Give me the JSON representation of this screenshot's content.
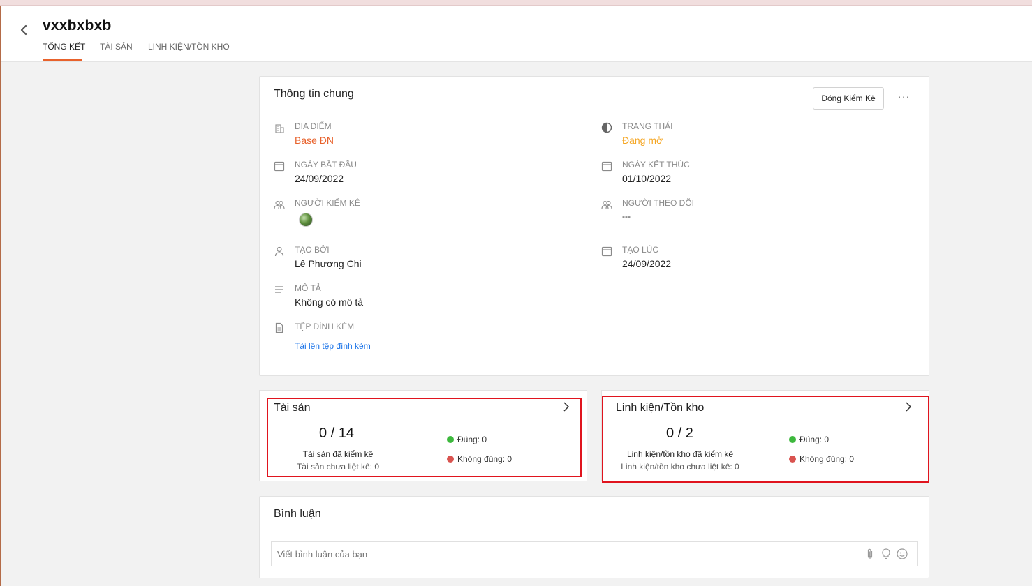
{
  "header": {
    "title": "vxxbxbxb",
    "tabs": [
      {
        "label": "TỔNG KẾT",
        "active": true
      },
      {
        "label": "TÀI SẢN",
        "active": false
      },
      {
        "label": "LINH KIỆN/TỒN KHO",
        "active": false
      }
    ]
  },
  "info": {
    "title": "Thông tin chung",
    "close_button": "Đóng Kiểm Kê",
    "more": "···",
    "fields": {
      "location": {
        "label": "ĐỊA ĐIỂM",
        "value": "Base ĐN"
      },
      "status": {
        "label": "TRẠNG THÁI",
        "value": "Đang mở"
      },
      "start_date": {
        "label": "NGÀY BẮT ĐẦU",
        "value": "24/09/2022"
      },
      "end_date": {
        "label": "NGÀY KẾT THÚC",
        "value": "01/10/2022"
      },
      "auditor": {
        "label": "NGƯỜI KIỂM KÊ"
      },
      "follower": {
        "label": "NGƯỜI THEO DÕI",
        "value": "---"
      },
      "created_by": {
        "label": "TẠO BỞI",
        "value": "Lê Phương Chi"
      },
      "created_at": {
        "label": "TẠO LÚC",
        "value": "24/09/2022"
      },
      "description": {
        "label": "MÔ TẢ",
        "value": "Không có mô tả"
      },
      "attachments": {
        "label": "TỆP ĐÍNH KÈM",
        "link": "Tải lên tệp đính kèm"
      }
    }
  },
  "assets": {
    "title": "Tài sản",
    "count": "0 / 14",
    "caption": "Tài sản đã kiểm kê",
    "sub": "Tài sản chưa liệt kê: 0",
    "correct": "Đúng: 0",
    "incorrect": "Không đúng: 0"
  },
  "parts": {
    "title": "Linh kiện/Tồn kho",
    "count": "0 / 2",
    "caption": "Linh kiện/tồn kho đã kiểm kê",
    "sub": "Linh kiện/tồn kho chưa liệt kê: 0",
    "correct": "Đúng: 0",
    "incorrect": "Không đúng: 0"
  },
  "comments": {
    "title": "Bình luận",
    "placeholder": "Viết bình luận của bạn"
  },
  "colors": {
    "accent": "#e8622c",
    "status_open": "#f5a623",
    "link": "#1a73e8",
    "correct": "#3db83d",
    "incorrect": "#d9534f",
    "highlight": "#e0141e"
  }
}
